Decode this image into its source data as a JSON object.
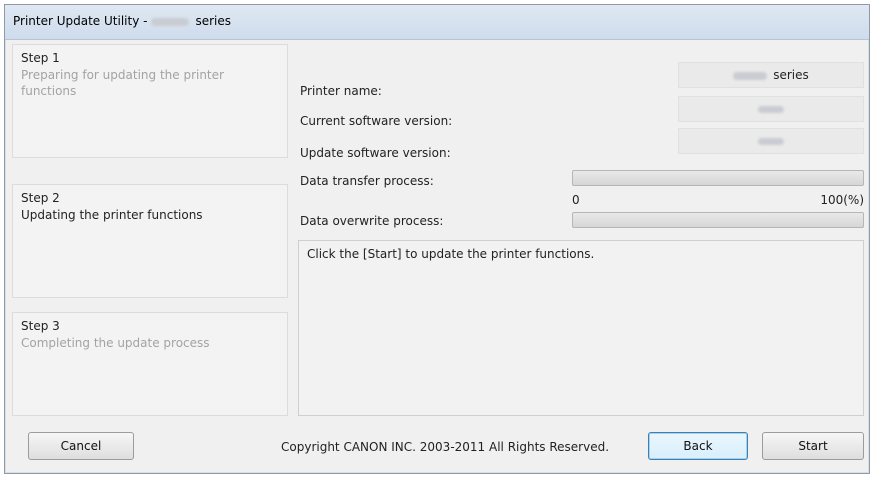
{
  "window": {
    "title_prefix": "Printer Update Utility -",
    "title_suffix": "series"
  },
  "steps": [
    {
      "title": "Step 1",
      "description": "Preparing for updating the printer functions",
      "state": "inactive"
    },
    {
      "title": "Step 2",
      "description": "Updating the printer functions",
      "state": "active"
    },
    {
      "title": "Step 3",
      "description": "Completing the update process",
      "state": "inactive"
    }
  ],
  "info": {
    "printer_name_label": "Printer name:",
    "printer_name_value_suffix": "series",
    "current_version_label": "Current software version:",
    "update_version_label": "Update software version:",
    "data_transfer_label": "Data transfer process:",
    "data_overwrite_label": "Data overwrite process:"
  },
  "progress": {
    "transfer_fraction": 0.0,
    "overwrite_fraction": 0.0,
    "scale_min": "0",
    "scale_max": "100(%)"
  },
  "message": {
    "text": "Click the [Start] to update the printer functions."
  },
  "buttons": {
    "cancel": "Cancel",
    "back": "Back",
    "start": "Start"
  },
  "footer": {
    "copyright": "Copyright CANON INC. 2003-2011 All Rights Reserved."
  }
}
